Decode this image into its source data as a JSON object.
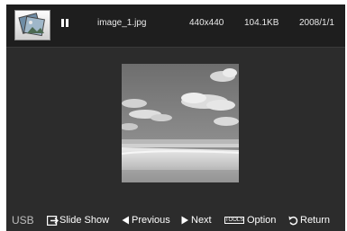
{
  "header": {
    "filename": "image_1.jpg",
    "resolution": "440x440",
    "filesize": "104.1KB",
    "date": "2008/1/1",
    "status_icon": "pause-icon",
    "thumbnail_icon": "photo-thumbnail-icon"
  },
  "viewer": {
    "photo": "beach-sky-photo-bw"
  },
  "footer": {
    "source": "USB",
    "actions": [
      {
        "label": "Slide Show",
        "icon": "slideshow-icon"
      },
      {
        "label": "Previous",
        "icon": "triangle-left-icon"
      },
      {
        "label": "Next",
        "icon": "triangle-right-icon"
      },
      {
        "label": "Option",
        "icon": "tools-icon",
        "badge": "TOOLS"
      },
      {
        "label": "Return",
        "icon": "return-arrow-icon"
      }
    ]
  },
  "colors": {
    "background": "#2c2c2c",
    "header": "#1e1e1e",
    "text": "#ffffff"
  }
}
